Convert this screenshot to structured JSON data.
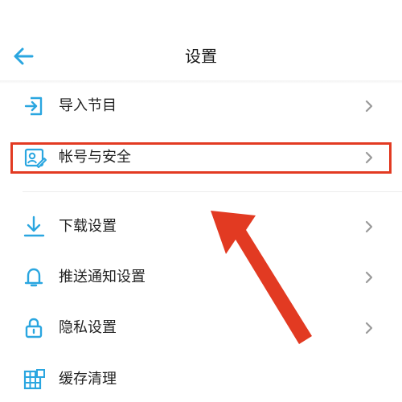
{
  "header": {
    "title": "设置"
  },
  "items": [
    {
      "label": "导入节目",
      "icon": "import-icon"
    },
    {
      "label": "帐号与安全",
      "icon": "account-security-icon"
    },
    {
      "label": "下载设置",
      "icon": "download-icon"
    },
    {
      "label": "推送通知设置",
      "icon": "bell-icon"
    },
    {
      "label": "隐私设置",
      "icon": "lock-icon"
    },
    {
      "label": "缓存清理",
      "icon": "cache-icon"
    }
  ],
  "colors": {
    "accent": "#2aa6e0",
    "annotation": "#e23a22",
    "chevron": "#9a9a9a"
  }
}
